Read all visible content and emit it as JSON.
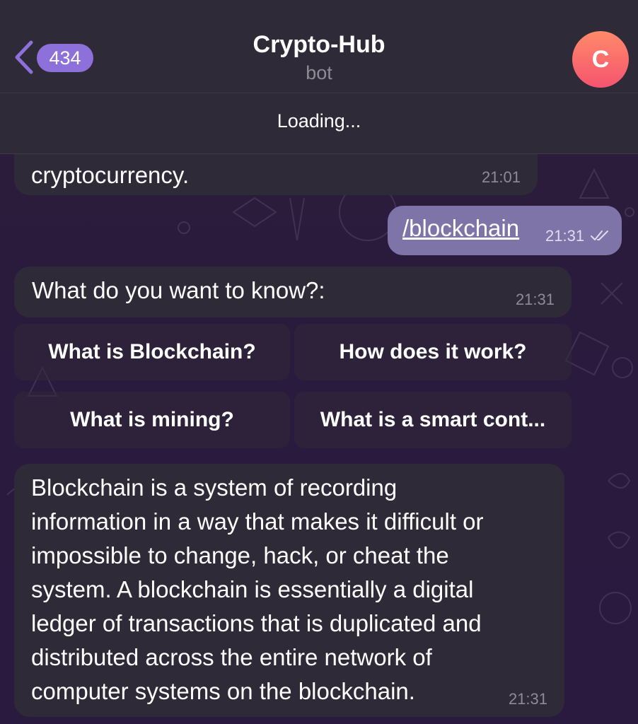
{
  "header": {
    "back_icon": "chevron-left-icon",
    "unread_count": "434",
    "title": "Crypto-Hub",
    "subtitle": "bot",
    "avatar_letter": "C"
  },
  "status": {
    "loading_text": "Loading..."
  },
  "messages": [
    {
      "direction": "incoming",
      "text": "cryptocurrency.",
      "time": "21:01"
    },
    {
      "direction": "outgoing",
      "text": "/blockchain",
      "time": "21:31",
      "status_icon": "double-check-icon"
    },
    {
      "direction": "incoming",
      "text": "What do you want to know?:",
      "time": "21:31"
    },
    {
      "direction": "incoming",
      "lines": [
        "Blockchain is a system of recording",
        "information in a way that makes it difficult or",
        "impossible to change, hack, or cheat the",
        "system. A blockchain is essentially a digital",
        "ledger of transactions that is duplicated and",
        "distributed across the entire network of",
        "computer systems on the blockchain."
      ],
      "time": "21:31"
    }
  ],
  "keyboard": {
    "buttons": [
      "What is Blockchain?",
      "How does it work?",
      "What is mining?",
      "What is a smart cont..."
    ]
  },
  "colors": {
    "accent": "#8d70d9",
    "header_bg": "#2f2a38",
    "incoming_bubble": "#2f2a38",
    "outgoing_bubble": "#7f74a8",
    "avatar_gradient_top": "#ff8a6a",
    "avatar_gradient_bottom": "#f5546e"
  }
}
